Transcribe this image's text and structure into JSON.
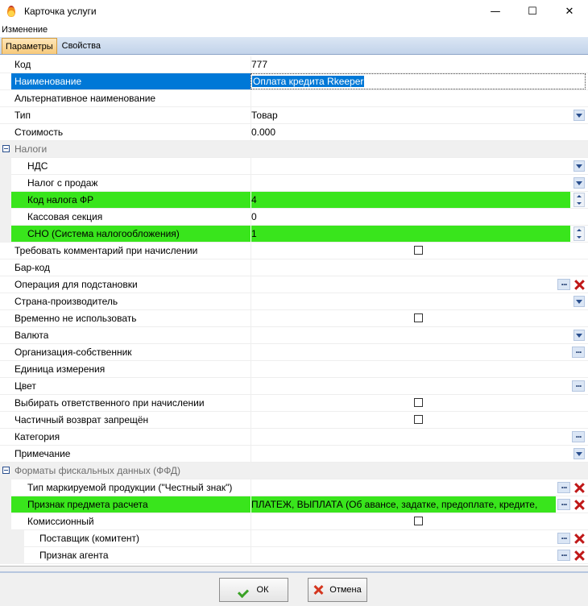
{
  "window": {
    "title": "Карточка услуги",
    "minimize": "—",
    "maximize": "☐",
    "close": "✕"
  },
  "caption": "Изменение",
  "tabs": [
    {
      "label": "Параметры",
      "active": true
    },
    {
      "label": "Свойства",
      "active": false
    }
  ],
  "grid": {
    "rows": [
      {
        "name": "Код",
        "value": "777"
      },
      {
        "name": "Наименование",
        "value": "Оплата кредита Rkeeper"
      },
      {
        "name": "Альтернативное наименование",
        "value": ""
      },
      {
        "name": "Тип",
        "value": "Товар"
      },
      {
        "name": "Стоимость",
        "value": "0.000"
      },
      {
        "name": "Налоги",
        "value": ""
      },
      {
        "name": "НДС",
        "value": ""
      },
      {
        "name": "Налог с продаж",
        "value": ""
      },
      {
        "name": "Код налога ФР",
        "value": "4"
      },
      {
        "name": "Кассовая секция",
        "value": "0"
      },
      {
        "name": "СНО (Система налогообложения)",
        "value": "1"
      },
      {
        "name": "Требовать комментарий при начислении",
        "value": ""
      },
      {
        "name": "Бар-код",
        "value": ""
      },
      {
        "name": "Операция для подстановки",
        "value": ""
      },
      {
        "name": "Страна-производитель",
        "value": ""
      },
      {
        "name": "Временно не использовать",
        "value": ""
      },
      {
        "name": "Валюта",
        "value": ""
      },
      {
        "name": "Организация-собственник",
        "value": ""
      },
      {
        "name": "Единица измерения",
        "value": ""
      },
      {
        "name": "Цвет",
        "value": ""
      },
      {
        "name": "Выбирать ответственного при начислении",
        "value": ""
      },
      {
        "name": "Частичный возврат запрещён",
        "value": ""
      },
      {
        "name": "Категория",
        "value": ""
      },
      {
        "name": "Примечание",
        "value": ""
      },
      {
        "name": "Форматы фискальных данных (ФФД)",
        "value": ""
      },
      {
        "name": "Тип маркируемой продукции (\"Честный знак\")",
        "value": ""
      },
      {
        "name": "Признак предмета расчета",
        "value": "ПЛАТЕЖ, ВЫПЛАТА (Об авансе, задатке, предоплате, кредите,"
      },
      {
        "name": "Комиссионный",
        "value": ""
      },
      {
        "name": "Поставщик (комитент)",
        "value": ""
      },
      {
        "name": "Признак агента",
        "value": ""
      }
    ]
  },
  "buttons": {
    "ok": "ОК",
    "cancel": "Отмена"
  },
  "colors": {
    "highlight_green": "#39e51c",
    "selection_blue": "#0078d7"
  }
}
